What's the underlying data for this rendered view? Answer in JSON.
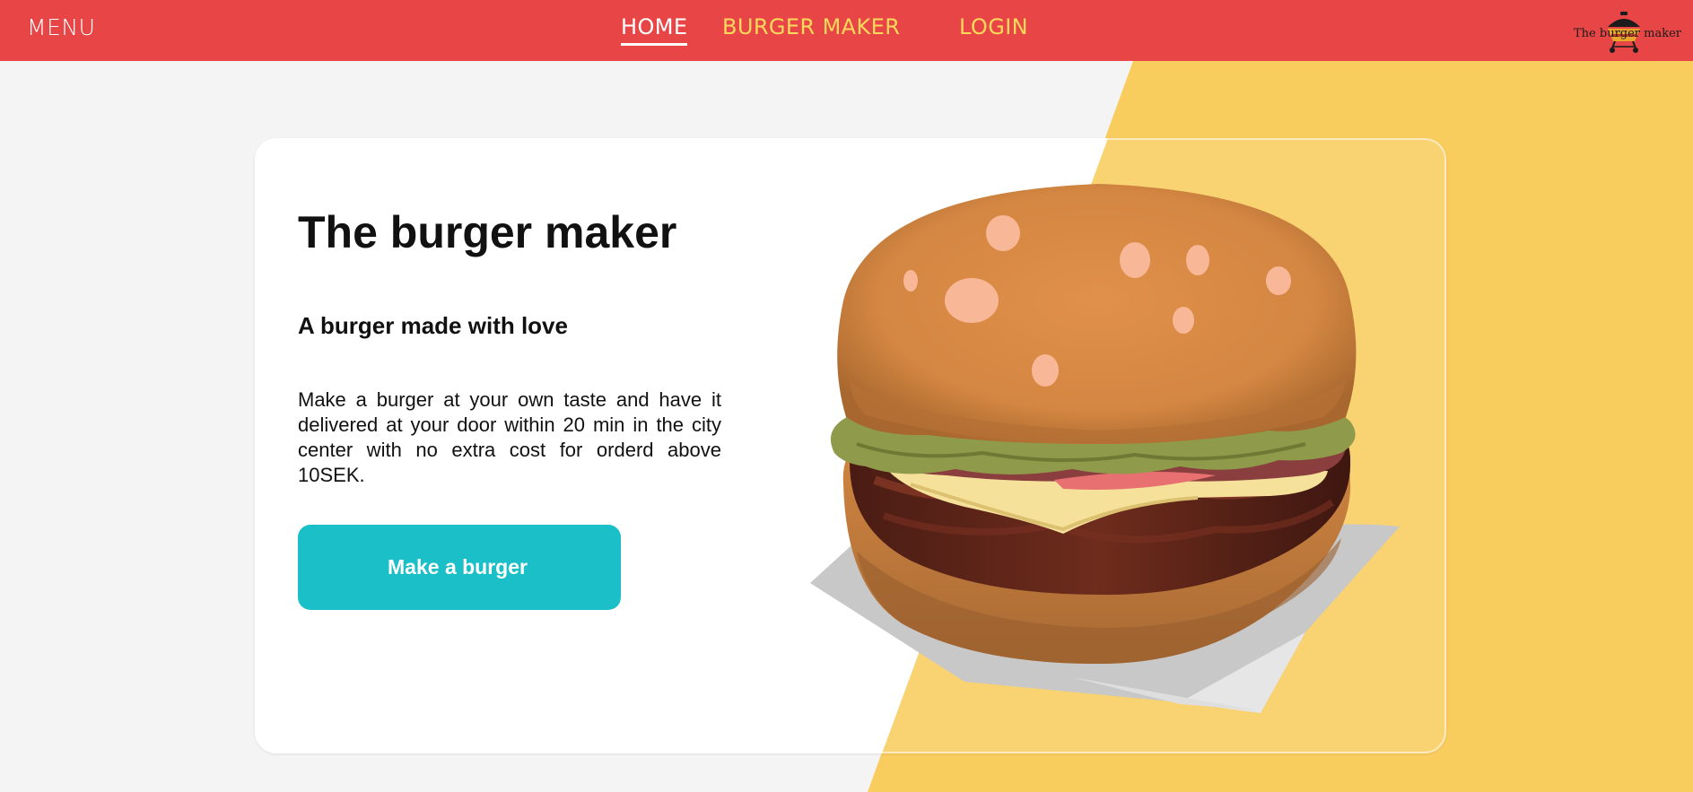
{
  "nav": {
    "menu_label": "MENU",
    "links": [
      {
        "label": "HOME",
        "active": true
      },
      {
        "label": "BURGER MAKER",
        "active": false
      },
      {
        "label": "LOGIN",
        "active": false
      }
    ],
    "logo_text": "The burger maker"
  },
  "hero": {
    "title": "The burger maker",
    "subtitle": "A burger made with love",
    "description": "Make a burger at your own taste and have it delivered at your door within 20 min in the city center with no extra cost for orderd above 10SEK.",
    "cta_label": "Make a burger"
  },
  "colors": {
    "header": "#e84646",
    "nav_link": "#fcd95a",
    "background": "#f4f4f4",
    "accent_yellow": "#f9cc5e",
    "cta": "#1bbfc7"
  },
  "icons": {
    "logo": "burger-grill-icon",
    "hero_image": "burger-illustration"
  }
}
